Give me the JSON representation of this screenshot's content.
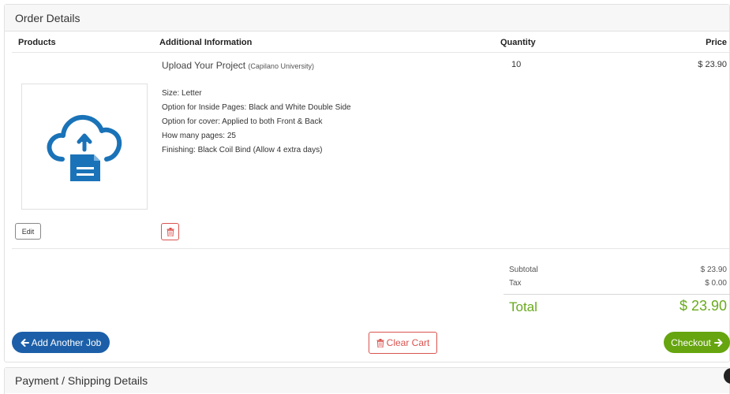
{
  "order_panel": {
    "title": "Order Details",
    "columns": {
      "products": "Products",
      "additional_info": "Additional Information",
      "quantity": "Quantity",
      "price": "Price"
    },
    "item": {
      "name": "Upload Your Project",
      "school": "(Capilano University)",
      "quantity": "10",
      "price": "$ 23.90",
      "options": [
        "Size: Letter",
        "Option for Inside Pages: Black and White Double Side",
        "Option for cover: Applied to both Front & Back",
        "How many pages: 25",
        "Finishing: Black Coil Bind (Allow 4 extra days)"
      ],
      "edit_label": "Edit"
    },
    "summary": {
      "subtotal_label": "Subtotal",
      "subtotal_value": "$ 23.90",
      "tax_label": "Tax",
      "tax_value": "$ 0.00",
      "total_label": "Total",
      "total_value": "$ 23.90"
    },
    "actions": {
      "add_job_label": "Add Another Job",
      "clear_cart_label": "Clear Cart",
      "checkout_label": "Checkout"
    }
  },
  "payment_panel": {
    "title": "Payment / Shipping Details"
  },
  "colors": {
    "primary_blue": "#1c5fa8",
    "success_green": "#66a50f",
    "danger_red": "#d9534f",
    "icon_blue": "#1a73b8",
    "total_green": "#6aaa1e"
  },
  "icons": {
    "upload": "cloud-upload-icon",
    "trash": "trash-icon",
    "arrow_left": "arrow-left-icon",
    "arrow_right": "arrow-right-icon"
  }
}
